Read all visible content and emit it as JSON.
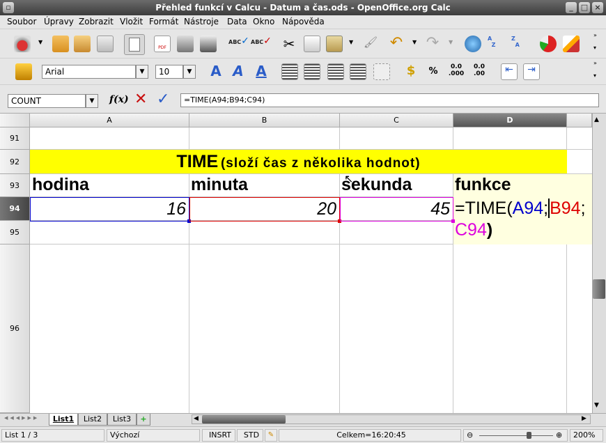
{
  "window": {
    "title": "Přehled funkcí v Calcu - Datum a čas.ods - OpenOffice.org Calc"
  },
  "menu": [
    "Soubor",
    "Úpravy",
    "Zobrazit",
    "Vložit",
    "Formát",
    "Nástroje",
    "Data",
    "Okno",
    "Nápověda"
  ],
  "format_bar": {
    "font_name": "Arial",
    "font_size": "10"
  },
  "formula_bar": {
    "name_box": "COUNT",
    "formula": "=TIME(A94;B94;C94)",
    "fx_label": "f(x)"
  },
  "columns": [
    "A",
    "B",
    "C",
    "D"
  ],
  "rows": [
    "91",
    "92",
    "93",
    "94",
    "95",
    "96"
  ],
  "cells": {
    "title_bold": "TIME",
    "title_rest": "(složí čas z několika hodnot)",
    "h_a": "hodina",
    "h_b": "minuta",
    "h_c": "sekunda",
    "h_d": "funkce",
    "a94": "16",
    "b94": "20",
    "c94": "45",
    "f_prefix": "=TIME(",
    "f_a": "A94",
    "f_sep1": ";",
    "f_b": "B94",
    "f_sep2": ";",
    "f_c": "C94",
    "f_suffix": ")"
  },
  "sheet_tabs": [
    "List1",
    "List2",
    "List3"
  ],
  "status": {
    "sheet": "List 1 / 3",
    "style": "Výchozí",
    "mode": "INSRT",
    "sel": "STD",
    "sum": "Celkem=16:20:45",
    "zoom": "200%"
  },
  "colors": {
    "ref_a": "#0000cc",
    "ref_b": "#dd0000",
    "ref_c": "#dd00dd",
    "title_bg": "#ffff00",
    "func_bg": "#ffffe0"
  }
}
